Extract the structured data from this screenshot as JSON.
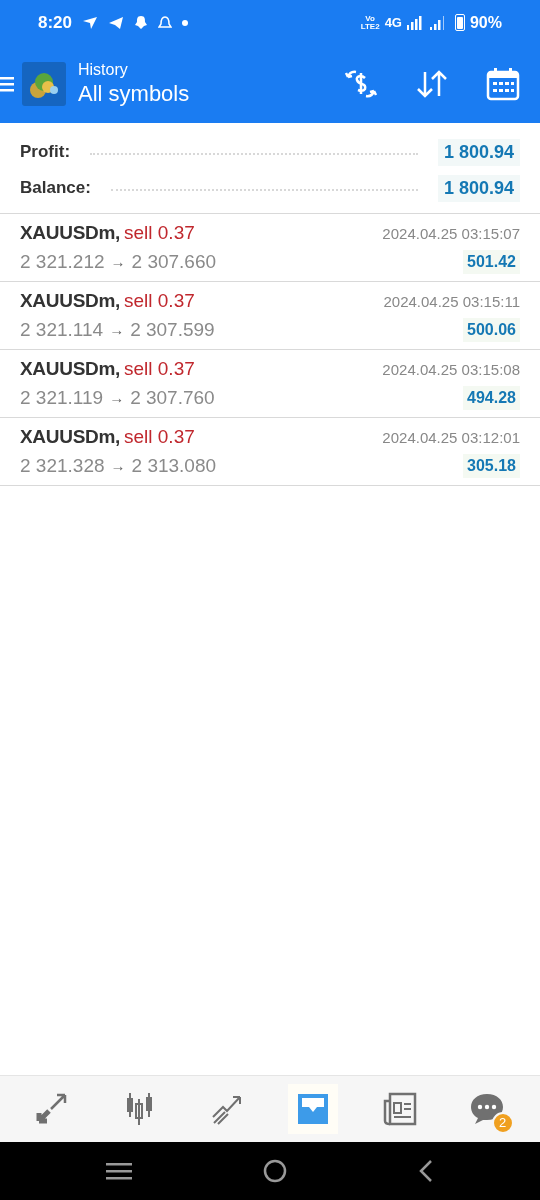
{
  "status_bar": {
    "time": "8:20",
    "volte": [
      "Vo",
      "LTE2"
    ],
    "network": "4G",
    "battery": "90%"
  },
  "header": {
    "subtitle": "History",
    "title": "All symbols"
  },
  "summary": [
    {
      "label": "Profit:",
      "value": "1 800.94"
    },
    {
      "label": "Balance:",
      "value": "1 800.94"
    }
  ],
  "deals": [
    {
      "symbol": "XAUUSDm,",
      "deal": "sell 0.37",
      "open_price": "2 321.212",
      "arrow": "→",
      "close_price": "2 307.660",
      "time": "2024.04.25 03:15:07",
      "profit": "501.42"
    },
    {
      "symbol": "XAUUSDm,",
      "deal": "sell 0.37",
      "open_price": "2 321.114",
      "arrow": "→",
      "close_price": "2 307.599",
      "time": "2024.04.25 03:15:11",
      "profit": "500.06"
    },
    {
      "symbol": "XAUUSDm,",
      "deal": "sell 0.37",
      "open_price": "2 321.119",
      "arrow": "→",
      "close_price": "2 307.760",
      "time": "2024.04.25 03:15:08",
      "profit": "494.28"
    },
    {
      "symbol": "XAUUSDm,",
      "deal": "sell 0.37",
      "open_price": "2 321.328",
      "arrow": "→",
      "close_price": "2 313.080",
      "time": "2024.04.25 03:12:01",
      "profit": "305.18"
    }
  ],
  "bottom_tabs": [
    {
      "kind": "trade",
      "selected": false
    },
    {
      "kind": "quotes",
      "selected": false
    },
    {
      "kind": "chart",
      "selected": false
    },
    {
      "kind": "history",
      "selected": true
    },
    {
      "kind": "news",
      "selected": false
    },
    {
      "kind": "chat",
      "selected": false,
      "badge": "2"
    }
  ]
}
